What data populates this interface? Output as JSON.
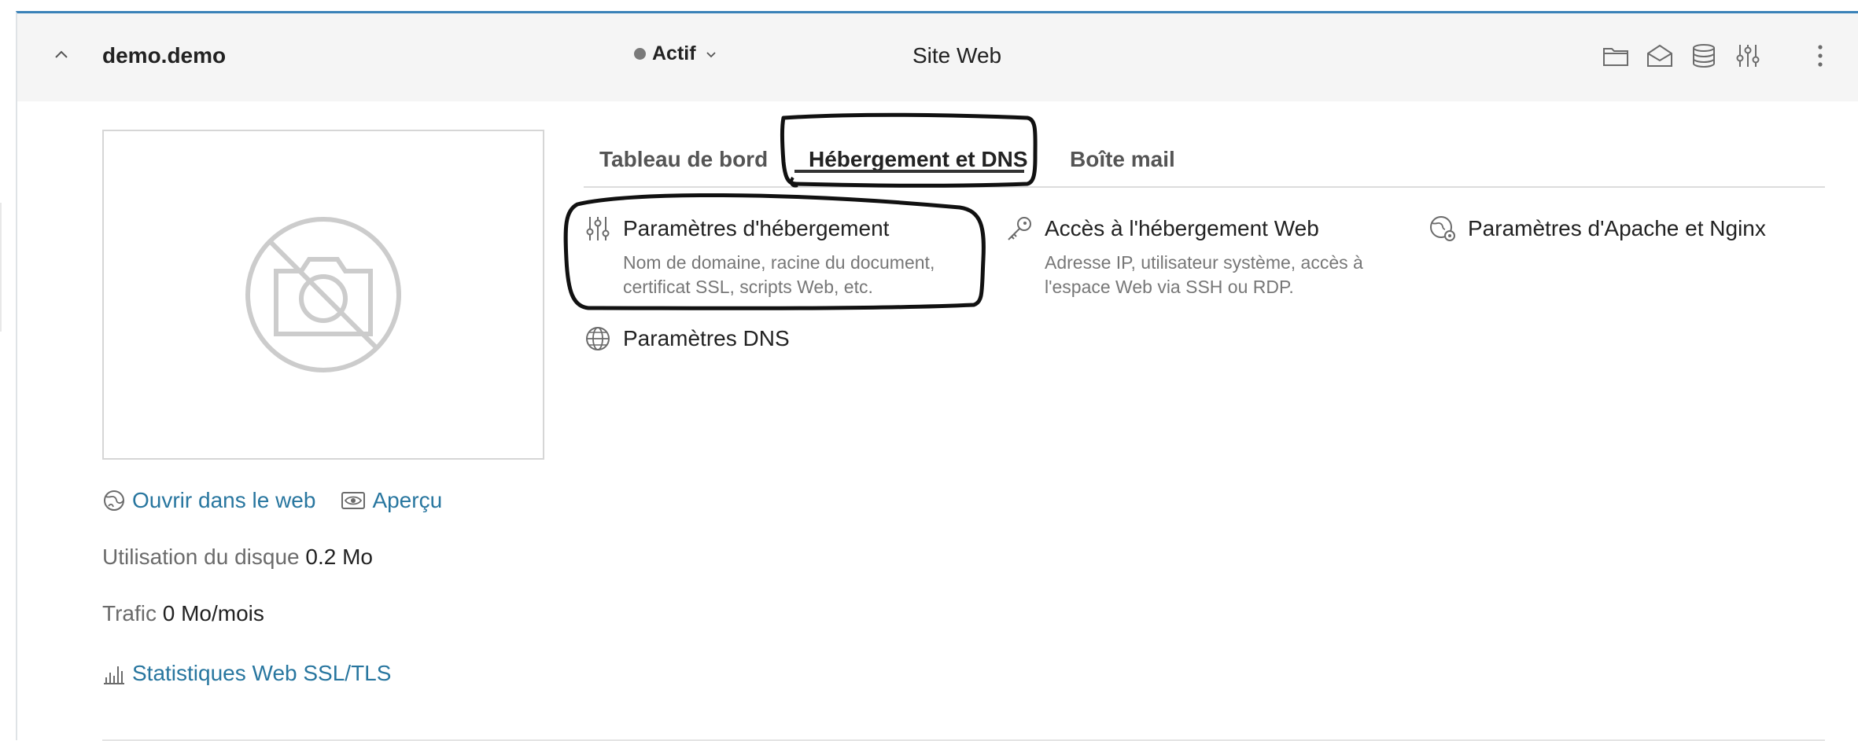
{
  "header": {
    "domain": "demo.demo",
    "status": "Actif",
    "site_type": "Site Web",
    "icons": [
      "chevron-up-icon",
      "folder-icon",
      "mail-open-icon",
      "database-icon",
      "sliders-icon",
      "more-vertical-icon"
    ]
  },
  "preview": {
    "placeholder_icon": "camera-off-icon",
    "open_web": "Ouvrir dans le web",
    "preview": "Aperçu"
  },
  "usage": {
    "disk_label": "Utilisation du disque",
    "disk_value": "0.2 Mo",
    "traffic_label": "Trafic",
    "traffic_value": "0 Mo/mois",
    "stats_link": "Statistiques Web SSL/TLS"
  },
  "tabs": [
    {
      "label": "Tableau de bord"
    },
    {
      "label": "Hébergement et DNS",
      "active": true
    },
    {
      "label": "Boîte mail"
    }
  ],
  "features": {
    "hosting_settings": {
      "title": "Paramètres d'hébergement",
      "desc1": "Nom de domaine, racine du document,",
      "desc2": "certificat SSL, scripts Web, etc."
    },
    "web_access": {
      "title": "Accès à l'hébergement Web",
      "desc1": "Adresse IP, utilisateur système, accès à",
      "desc2": "l'espace Web via SSH ou RDP."
    },
    "apache_nginx": {
      "title": "Paramètres d'Apache et Nginx"
    },
    "dns": {
      "title": "Paramètres DNS"
    }
  },
  "colors": {
    "accent_border": "#3a82b8",
    "link": "#28769f",
    "status_dot": "#7a7a7a",
    "header_bg": "#f5f5f5"
  }
}
